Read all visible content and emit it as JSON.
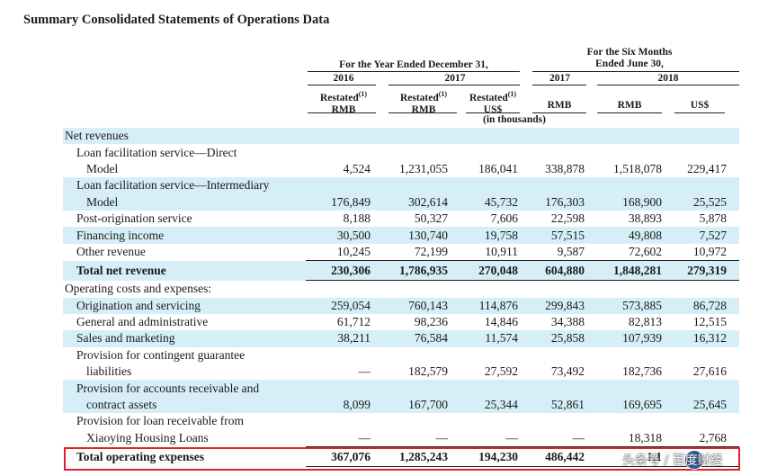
{
  "title": "Summary Consolidated Statements of Operations Data",
  "header": {
    "year_group": "For the Year Ended December 31,",
    "six_month_group_line1": "For the Six Months",
    "six_month_group_line2": "Ended June 30,",
    "year_2016": "2016",
    "year_2017": "2017",
    "h1_2017": "2017",
    "h1_2018": "2018",
    "columns": [
      {
        "line1": "Restated",
        "sup": "(1)",
        "line2": "RMB"
      },
      {
        "line1": "Restated",
        "sup": "(1)",
        "line2": "RMB"
      },
      {
        "line1": "Restated",
        "sup": "(1)",
        "line2": "US$"
      },
      {
        "line1": "",
        "sup": "",
        "line2": "RMB"
      },
      {
        "line1": "",
        "sup": "",
        "line2": "RMB"
      },
      {
        "line1": "",
        "sup": "",
        "line2": "US$"
      }
    ],
    "unit_note": "(in thousands)"
  },
  "rows": [
    {
      "label": "Net revenues",
      "values": [
        "",
        "",
        "",
        "",
        "",
        ""
      ]
    },
    {
      "label": "Loan facilitation service—Direct",
      "values": [
        "",
        "",
        "",
        "",
        "",
        ""
      ]
    },
    {
      "label": "Model",
      "values": [
        "4,524",
        "1,231,055",
        "186,041",
        "338,878",
        "1,518,078",
        "229,417"
      ]
    },
    {
      "label": "Loan facilitation service—Intermediary",
      "values": [
        "",
        "",
        "",
        "",
        "",
        ""
      ]
    },
    {
      "label": "Model",
      "values": [
        "176,849",
        "302,614",
        "45,732",
        "176,303",
        "168,900",
        "25,525"
      ]
    },
    {
      "label": "Post-origination service",
      "values": [
        "8,188",
        "50,327",
        "7,606",
        "22,598",
        "38,893",
        "5,878"
      ]
    },
    {
      "label": "Financing income",
      "values": [
        "30,500",
        "130,740",
        "19,758",
        "57,515",
        "49,808",
        "7,527"
      ]
    },
    {
      "label": "Other revenue",
      "values": [
        "10,245",
        "72,199",
        "10,911",
        "9,587",
        "72,602",
        "10,972"
      ]
    },
    {
      "label": "Total net revenue",
      "values": [
        "230,306",
        "1,786,935",
        "270,048",
        "604,880",
        "1,848,281",
        "279,319"
      ]
    },
    {
      "label": "Operating costs and expenses:",
      "values": [
        "",
        "",
        "",
        "",
        "",
        ""
      ]
    },
    {
      "label": "Origination and servicing",
      "values": [
        "259,054",
        "760,143",
        "114,876",
        "299,843",
        "573,885",
        "86,728"
      ]
    },
    {
      "label": "General and administrative",
      "values": [
        "61,712",
        "98,236",
        "14,846",
        "34,388",
        "82,813",
        "12,515"
      ]
    },
    {
      "label": "Sales and marketing",
      "values": [
        "38,211",
        "76,584",
        "11,574",
        "25,858",
        "107,939",
        "16,312"
      ]
    },
    {
      "label": "Provision for contingent guarantee",
      "values": [
        "",
        "",
        "",
        "",
        "",
        ""
      ]
    },
    {
      "label": "liabilities",
      "values": [
        "—",
        "182,579",
        "27,592",
        "73,492",
        "182,736",
        "27,616"
      ]
    },
    {
      "label": "Provision for accounts receivable and",
      "values": [
        "",
        "",
        "",
        "",
        "",
        ""
      ]
    },
    {
      "label": "contract assets",
      "values": [
        "8,099",
        "167,700",
        "25,344",
        "52,861",
        "169,695",
        "25,645"
      ]
    },
    {
      "label": "Provision for loan receivable from",
      "values": [
        "",
        "",
        "",
        "",
        "",
        ""
      ]
    },
    {
      "label": "Xiaoying Housing Loans",
      "values": [
        "—",
        "—",
        "—",
        "—",
        "18,318",
        "2,768"
      ]
    },
    {
      "label": "Total operating expenses",
      "values": [
        "367,076",
        "1,285,243",
        "194,230",
        "486,442",
        "1,1",
        ""
      ]
    }
  ],
  "watermark": "头条号 / 百度财经",
  "colors": {
    "shade": "#d6eef8",
    "highlight_border": "#e0202a"
  }
}
